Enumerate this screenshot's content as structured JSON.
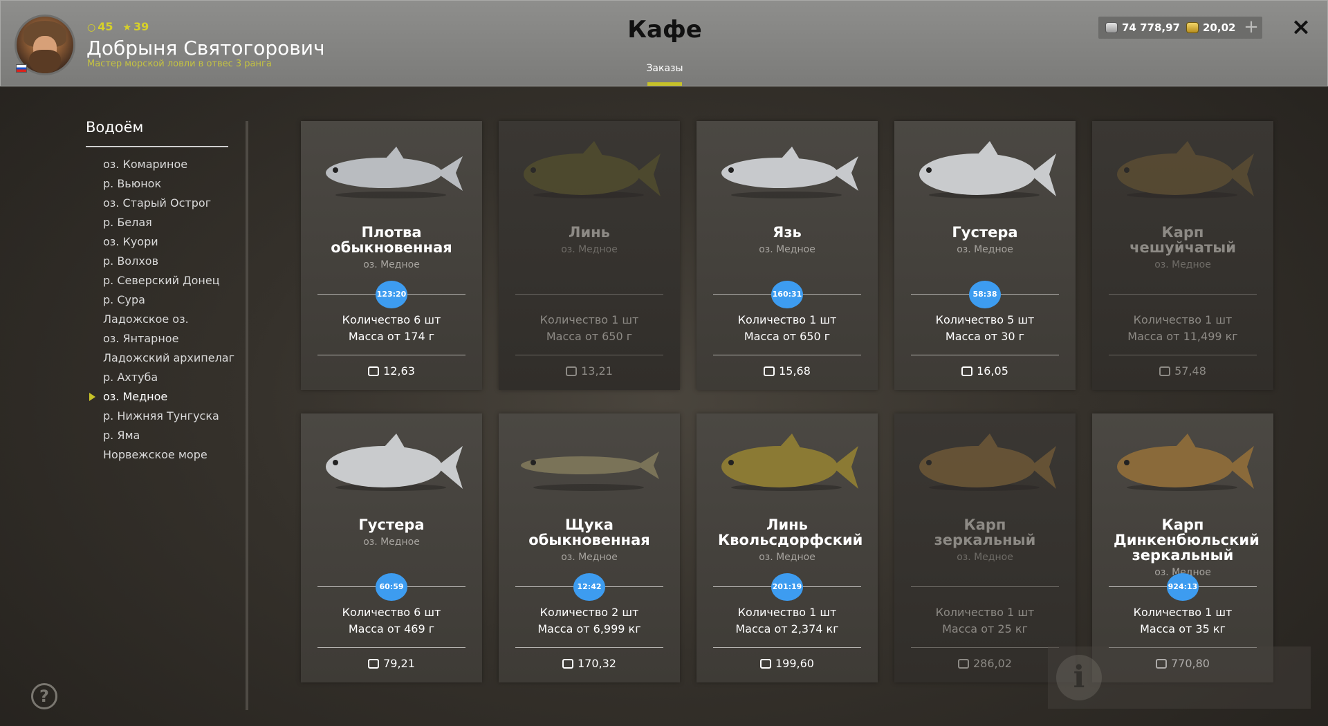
{
  "player": {
    "level": "45",
    "stars": "39",
    "name": "Добрыня Святогорович",
    "rank": "Мастер морской ловли в отвес 3 ранга"
  },
  "page": {
    "title": "Кафе",
    "tab": "Заказы"
  },
  "currency": {
    "silver": "74 778,97",
    "gold": "20,02",
    "add_label": "+"
  },
  "icons": {
    "close": "×",
    "help": "?",
    "info": "i",
    "level": "○",
    "star": "★"
  },
  "sidebar": {
    "title": "Водоём",
    "items": [
      "оз. Комариное",
      "р. Вьюнок",
      "оз. Старый Острог",
      "р. Белая",
      "оз. Куори",
      "р. Волхов",
      "р. Северский Донец",
      "р. Сура",
      "Ладожское оз.",
      "оз. Янтарное",
      "Ладожский архипелаг",
      "р. Ахтуба",
      "оз. Медное",
      "р. Нижняя Тунгуска",
      "р. Яма",
      "Норвежское море"
    ],
    "active_index": 12
  },
  "orders": [
    {
      "name": "Плотва обыкновенная",
      "lake": "оз. Медное",
      "timer": "123:20",
      "quantity": "Количество 6 шт",
      "mass": "Масса от 174 г",
      "price": "12,63",
      "available": true
    },
    {
      "name": "Линь",
      "lake": "оз. Медное",
      "timer": "",
      "quantity": "Количество 1 шт",
      "mass": "Масса от 650 г",
      "price": "13,21",
      "available": false
    },
    {
      "name": "Язь",
      "lake": "оз. Медное",
      "timer": "160:31",
      "quantity": "Количество 1 шт",
      "mass": "Масса от 650 г",
      "price": "15,68",
      "available": true
    },
    {
      "name": "Густера",
      "lake": "оз. Медное",
      "timer": "58:38",
      "quantity": "Количество 5 шт",
      "mass": "Масса от 30 г",
      "price": "16,05",
      "available": true
    },
    {
      "name": "Карп чешуйчатый",
      "lake": "оз. Медное",
      "timer": "",
      "quantity": "Количество 1 шт",
      "mass": "Масса от 11,499 кг",
      "price": "57,48",
      "available": false
    },
    {
      "name": "Густера",
      "lake": "оз. Медное",
      "timer": "60:59",
      "quantity": "Количество 6 шт",
      "mass": "Масса от 469 г",
      "price": "79,21",
      "available": true
    },
    {
      "name": "Щука обыкновенная",
      "lake": "оз. Медное",
      "timer": "12:42",
      "quantity": "Количество 2 шт",
      "mass": "Масса от 6,999 кг",
      "price": "170,32",
      "available": true
    },
    {
      "name": "Линь Квольсдорфский",
      "lake": "оз. Медное",
      "timer": "201:19",
      "quantity": "Количество 1 шт",
      "mass": "Масса от 2,374 кг",
      "price": "199,60",
      "available": true
    },
    {
      "name": "Карп зеркальный",
      "lake": "оз. Медное",
      "timer": "",
      "quantity": "Количество 1 шт",
      "mass": "Масса от 25 кг",
      "price": "286,02",
      "available": false
    },
    {
      "name": "Карп Динкенбюльский зеркальный",
      "lake": "оз. Медное",
      "timer": "924:13",
      "quantity": "Количество 1 шт",
      "mass": "Масса от 35 кг",
      "price": "770,80",
      "available": true
    }
  ],
  "fish_colors": {
    "roach": "#b9bcc0",
    "tench": "#5f5a2c",
    "ide": "#c7c9cc",
    "bream": "#c9cbcd",
    "carp": "#6e5a34",
    "pike": "#7a7358",
    "golden_tench": "#8b7a34",
    "mirror_carp": "#8a6a3a"
  },
  "accent_color": "#c7c228",
  "timer_color": "#3d9cf0"
}
